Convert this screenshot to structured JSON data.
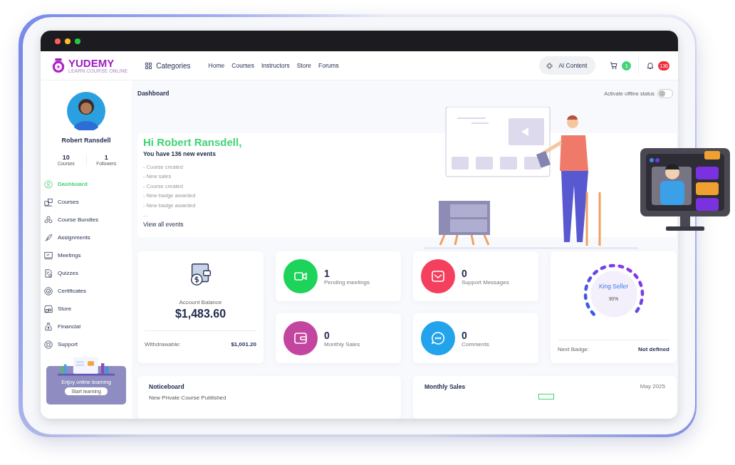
{
  "window": {
    "controls": [
      {
        "color": "#ff5f57"
      },
      {
        "color": "#febc2e"
      },
      {
        "color": "#28c840"
      }
    ]
  },
  "header": {
    "logo": "YUDEMY",
    "tagline": "LEARN COURSE ONLINE",
    "categories": "Categories",
    "nav": [
      "Home",
      "Courses",
      "Instructors",
      "Store",
      "Forums"
    ],
    "ai_button": "AI Content",
    "cart_count": "1",
    "notification_count": "136"
  },
  "sidebar": {
    "name": "Robert Ransdell",
    "stats": [
      {
        "value": "10",
        "label": "Courses"
      },
      {
        "value": "1",
        "label": "Followers"
      }
    ],
    "items": [
      {
        "label": "Dashboard",
        "kind": "dashboard",
        "selected": true
      },
      {
        "label": "Courses",
        "kind": "courses",
        "selected": false
      },
      {
        "label": "Course Bundles",
        "kind": "bundles",
        "selected": false
      },
      {
        "label": "Assignments",
        "kind": "assignments",
        "selected": false
      },
      {
        "label": "Meetings",
        "kind": "meetings",
        "selected": false
      },
      {
        "label": "Quizzes",
        "kind": "quizzes",
        "selected": false
      },
      {
        "label": "Certificates",
        "kind": "certificates",
        "selected": false
      },
      {
        "label": "Store",
        "kind": "store",
        "selected": false
      },
      {
        "label": "Financial",
        "kind": "financial",
        "selected": false
      },
      {
        "label": "Support",
        "kind": "support",
        "selected": false
      }
    ],
    "promo": {
      "text": "Enjoy online learning",
      "button": "Start learning"
    }
  },
  "page_title": "Dashboard",
  "offline_toggle": {
    "label": "Activate offline status",
    "on": false
  },
  "hero": {
    "greeting": "Hi Robert Ransdell,",
    "subtitle": "You have 136 new events",
    "events": [
      "- Course created",
      "- New sales",
      "- Course created",
      "- New badge awarded",
      "- New badge awarded",
      "..."
    ],
    "link": "View all events"
  },
  "balance": {
    "label": "Account Balance",
    "amount": "$1,483.60",
    "withdrawable_label": "Withdrawable:",
    "withdrawable": "$1,001.20"
  },
  "stats": [
    {
      "value": "1",
      "label": "Pending meetings",
      "kind": "meetings",
      "color": "#1ed35a"
    },
    {
      "value": "0",
      "label": "Support Messages",
      "kind": "messages",
      "color": "#f43f5e"
    },
    {
      "value": "0",
      "label": "Monthly Sales",
      "kind": "sales",
      "color": "#c2459f"
    },
    {
      "value": "0",
      "label": "Comments",
      "kind": "comments",
      "color": "#22a3ec"
    }
  ],
  "badge": {
    "name": "King Seller",
    "percent": "90%",
    "next_label": "Next Badge:",
    "next_value": "Not defined"
  },
  "noticeboard": {
    "title": "Noticeboard",
    "items": [
      "New Private Course Published"
    ]
  },
  "monthly_sales": {
    "title": "Monthly Sales",
    "period": "May 2025"
  }
}
